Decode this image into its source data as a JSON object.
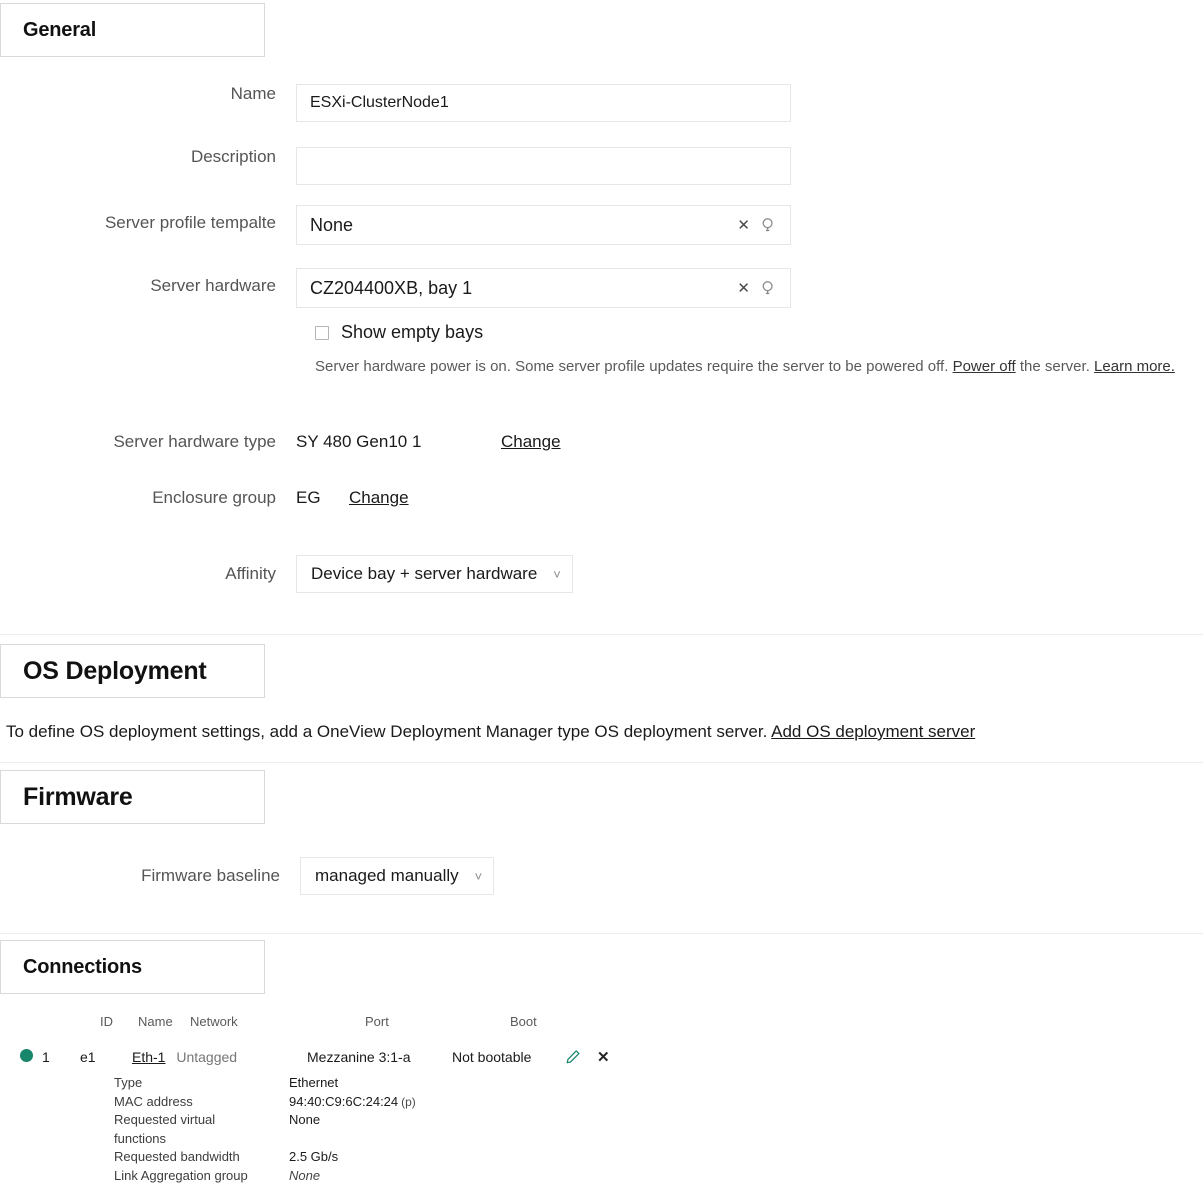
{
  "sections": {
    "general": {
      "title": "General"
    },
    "os_deployment": {
      "title": "OS Deployment",
      "body_text": "To define OS deployment settings, add a OneView Deployment Manager type OS deployment server.",
      "add_link": "Add OS deployment server"
    },
    "firmware": {
      "title": "Firmware"
    },
    "connections": {
      "title": "Connections"
    }
  },
  "general": {
    "name": {
      "label": "Name",
      "value": "ESXi-ClusterNode1"
    },
    "description": {
      "label": "Description",
      "value": ""
    },
    "server_profile_template": {
      "label": "Server profile tempalte",
      "value": "None",
      "clear_icon": "close-icon",
      "search_icon": "search-icon"
    },
    "server_hardware": {
      "label": "Server hardware",
      "value": "CZ204400XB, bay 1",
      "clear_icon": "close-icon",
      "search_icon": "search-icon"
    },
    "show_empty_bays": {
      "label": "Show empty bays",
      "checked": false
    },
    "power_note": {
      "text_1": "Server hardware power is on. Some server profile updates require the server to be powered off.",
      "power_off_link": "Power off",
      "text_2": "the server.",
      "learn_more_link": "Learn more."
    },
    "server_hardware_type": {
      "label": "Server hardware type",
      "value": "SY 480 Gen10 1",
      "change_link": "Change"
    },
    "enclosure_group": {
      "label": "Enclosure group",
      "value": "EG",
      "change_link": "Change"
    },
    "affinity": {
      "label": "Affinity",
      "value": "Device bay + server hardware",
      "caret_icon": "chevron-down-icon"
    }
  },
  "firmware": {
    "baseline": {
      "label": "Firmware baseline",
      "value": "managed manually",
      "caret_icon": "chevron-down-icon"
    }
  },
  "connections": {
    "columns": [
      "ID",
      "Name",
      "Network",
      "Port",
      "Boot"
    ],
    "rows": [
      {
        "status": "ok",
        "id": "1",
        "name": "e1",
        "network_link": "Eth-1",
        "network_tag": "Untagged",
        "port": "Mezzanine 3:1-a",
        "boot": "Not bootable",
        "edit_icon": "pencil-icon",
        "delete_icon": "close-icon",
        "details": [
          {
            "key": "Type",
            "value": "Ethernet",
            "italic": false,
            "suffix": ""
          },
          {
            "key": "MAC address",
            "value": "94:40:C9:6C:24:24",
            "italic": false,
            "suffix": "(p)"
          },
          {
            "key": "Requested virtual functions",
            "value": "None",
            "italic": false,
            "suffix": ""
          },
          {
            "key": "Requested bandwidth",
            "value": "2.5 Gb/s",
            "italic": false,
            "suffix": ""
          },
          {
            "key": "Link Aggregation group",
            "value": "None",
            "italic": true,
            "suffix": ""
          }
        ]
      }
    ]
  },
  "colors": {
    "status_ok": "#17866b",
    "accent": "#17866b",
    "border": "#e6e6e6",
    "label_text": "#555555"
  }
}
